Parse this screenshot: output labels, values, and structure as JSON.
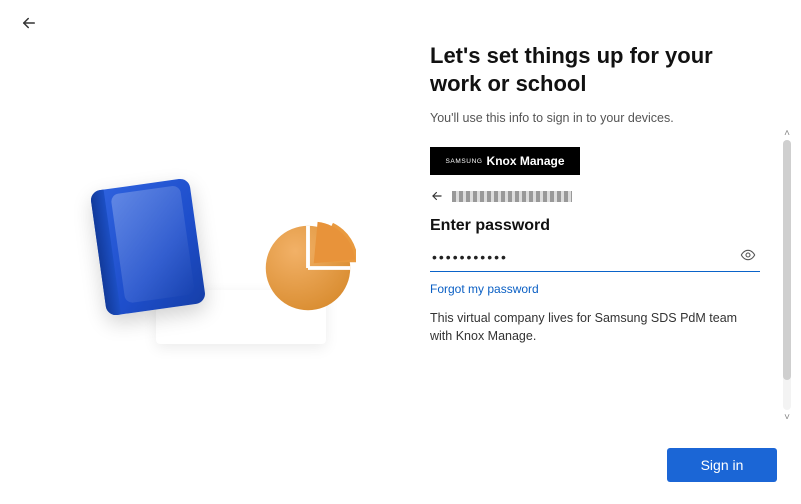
{
  "header": {
    "title": "Let's set things up for your work or school",
    "subtitle": "You'll use this info to sign in to your devices."
  },
  "brand": {
    "vendor": "SAMSUNG",
    "product": "Knox Manage"
  },
  "account": {
    "masked_email_placeholder": "████████████"
  },
  "password": {
    "label": "Enter password",
    "value": "•••••••••••",
    "forgot_link": "Forgot my password"
  },
  "company_description": "This virtual company lives for Samsung SDS PdM team with Knox Manage.",
  "actions": {
    "sign_in": "Sign in"
  },
  "colors": {
    "accent": "#1b66d6",
    "link": "#0a5fc4"
  }
}
